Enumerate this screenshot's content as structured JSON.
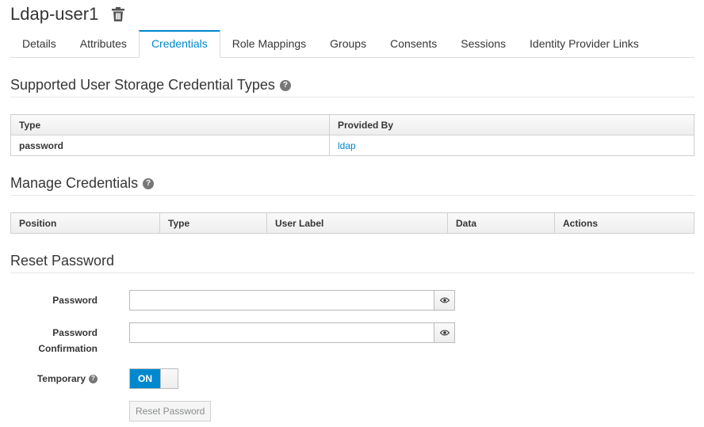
{
  "header": {
    "title": "Ldap-user1",
    "delete_icon": "trash-icon"
  },
  "tabs": [
    {
      "label": "Details",
      "active": false
    },
    {
      "label": "Attributes",
      "active": false
    },
    {
      "label": "Credentials",
      "active": true
    },
    {
      "label": "Role Mappings",
      "active": false
    },
    {
      "label": "Groups",
      "active": false
    },
    {
      "label": "Consents",
      "active": false
    },
    {
      "label": "Sessions",
      "active": false
    },
    {
      "label": "Identity Provider Links",
      "active": false
    }
  ],
  "supported": {
    "title": "Supported User Storage Credential Types",
    "columns": [
      "Type",
      "Provided By"
    ],
    "rows": [
      {
        "type": "password",
        "provided_by": "ldap"
      }
    ]
  },
  "manage": {
    "title": "Manage Credentials",
    "columns": [
      "Position",
      "Type",
      "User Label",
      "Data",
      "Actions"
    ]
  },
  "reset": {
    "title": "Reset Password",
    "password_label": "Password",
    "password_value": "",
    "confirmation_label_line1": "Password",
    "confirmation_label_line2": "Confirmation",
    "confirmation_value": "",
    "temporary_label": "Temporary",
    "temporary_state": "ON",
    "button_label": "Reset Password"
  },
  "colors": {
    "accent": "#0088ce",
    "text": "#363636",
    "border": "#d1d1d1"
  }
}
